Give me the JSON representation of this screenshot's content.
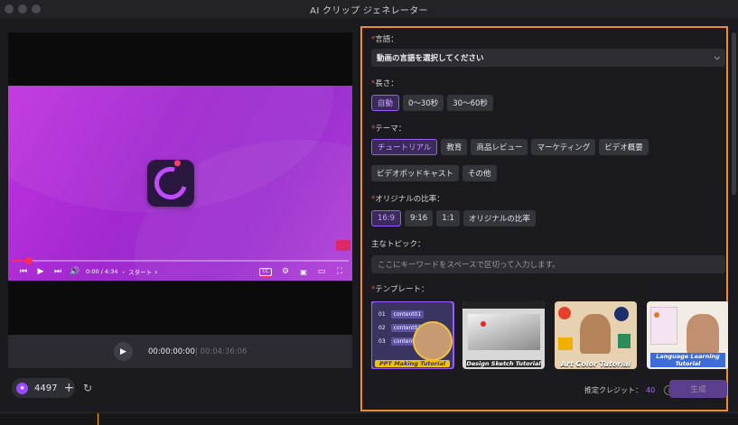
{
  "window": {
    "title": "AI クリップ ジェネレーター"
  },
  "video": {
    "current_time": "0:00 / 4:34",
    "chapter": "・ スタート",
    "chapter_chevron": "›",
    "progress_fraction": 0.05
  },
  "player": {
    "current_time": "00:00:00:00",
    "separator_total": "| 00:04:36:06"
  },
  "credits": {
    "count": "4497"
  },
  "form": {
    "language": {
      "label": "言語：",
      "value": "動画の言語を選択してください"
    },
    "length": {
      "label": "長さ：",
      "options": [
        "自動",
        "0～30秒",
        "30～60秒"
      ],
      "selected": "自動"
    },
    "theme": {
      "label": "テーマ：",
      "row1": [
        "チュートリアル",
        "教育",
        "商品レビュー",
        "マーケティング",
        "ビデオ概要"
      ],
      "row2": [
        "ビデオポッドキャスト",
        "その他"
      ],
      "selected": "チュートリアル"
    },
    "ratio": {
      "label": "オリジナルの比率：",
      "options": [
        "16:9",
        "9:16",
        "1:1",
        "オリジナルの比率"
      ],
      "selected": "16:9"
    },
    "topic": {
      "label": "主なトピック：",
      "placeholder": "ここにキーワードをスペースで区切って入力します。"
    },
    "template": {
      "label": "テンプレート：",
      "items": [
        {
          "caption": "PPT Making Tutorial",
          "rows": [
            "01",
            "02",
            "03"
          ],
          "row_text": "content01"
        },
        {
          "caption": "Design Sketch Tutorial"
        },
        {
          "caption": "Art Color Tutorial"
        },
        {
          "caption": "Language Learning Tutorial"
        }
      ]
    },
    "estimate": {
      "label": "推定クレジット：",
      "value": "40"
    },
    "generate_label": "生成"
  },
  "colors": {
    "accent": "#9a5cff",
    "panel_border": "#f08a33",
    "required": "#ff4a4a"
  }
}
